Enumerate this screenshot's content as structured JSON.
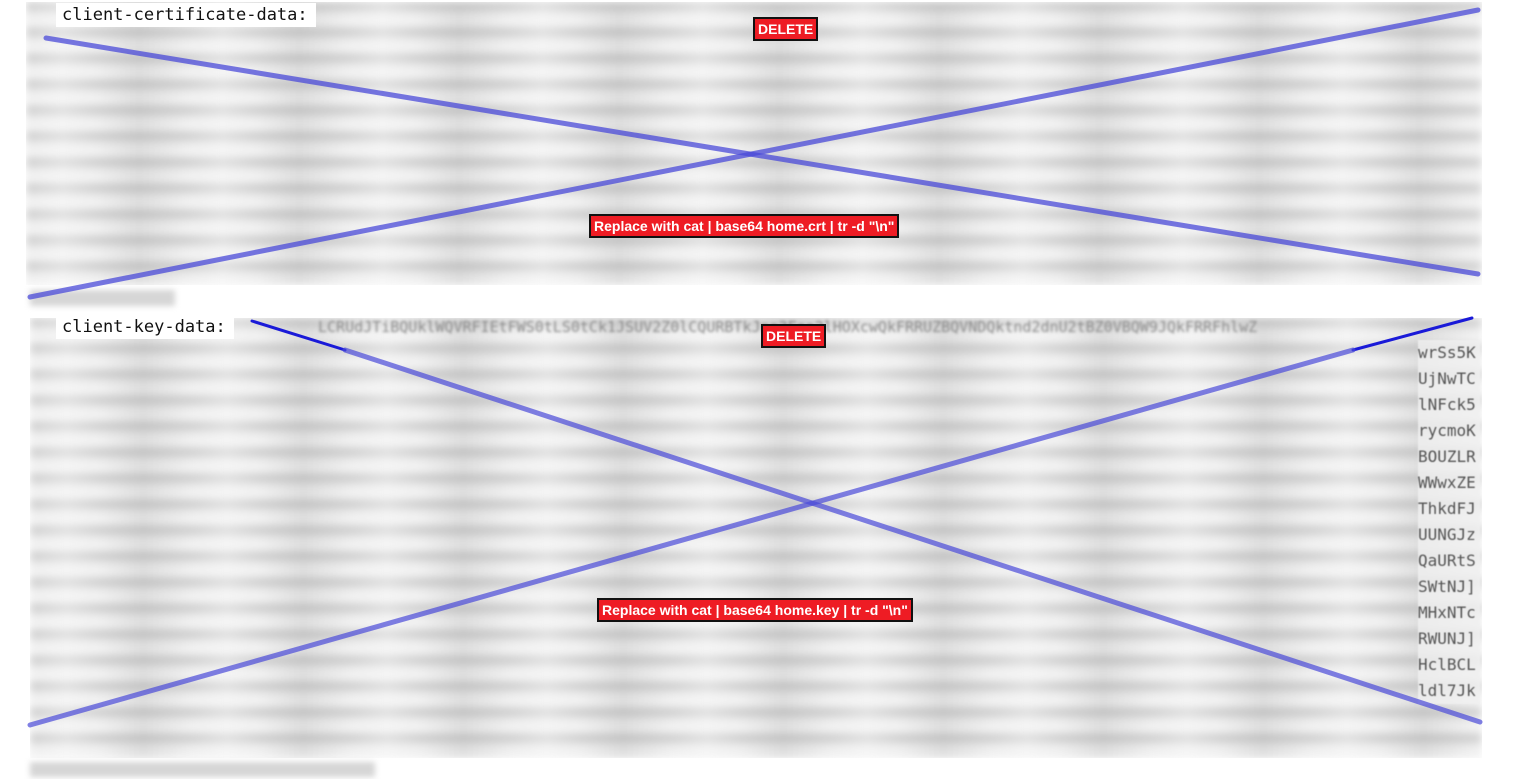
{
  "cert": {
    "key_label": "client-certificate-data:",
    "delete_label": "DELETE",
    "replace_label": "Replace with  cat | base64 home.crt | tr -d \"\\n\""
  },
  "key": {
    "key_label": "client-key-data:",
    "delete_label": "DELETE",
    "replace_label": "Replace with cat | base64 home.key | tr -d \"\\n\"",
    "first_line_fragment": "LCRUdJTiBQUklWQVRFIEtFWS0tLS0tCk1JSUV2Z0lCQURBTkJna3Foa2lHOXcwQkFRRUZBQVNDQktnd2dnU2tBZ0VBQW9JQkFRRFhlwZ",
    "edge_fragments": [
      "wrSs5K",
      "UjNwTC",
      "lNFck5",
      "rycmoK",
      "BOUZLR",
      "WWwxZE",
      "ThkdFJ",
      "UUNGJz",
      "QaURtS",
      "SWtNJ]",
      "MHxNTc",
      "RWUNJ]",
      "HclBCL",
      "ldl7Jk"
    ]
  },
  "colors": {
    "annotation_bg": "#ee1c24",
    "annotation_text": "#ffffff",
    "cross_stroke": "#3333cc"
  }
}
